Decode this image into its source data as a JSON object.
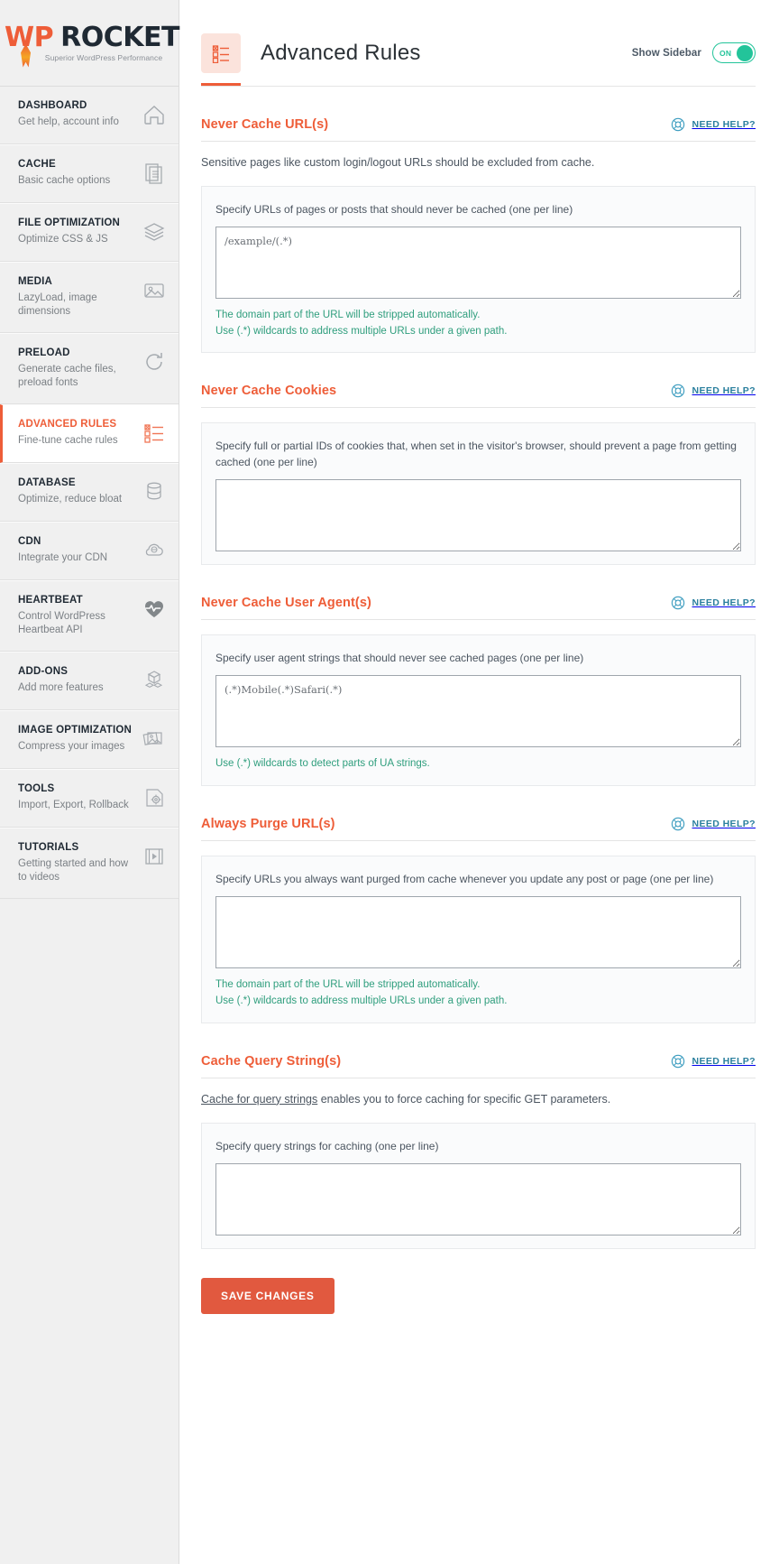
{
  "brand": {
    "logo_wp": "WP",
    "logo_rocket": "ROCKET",
    "tagline": "Superior WordPress Performance",
    "accent_orange": "#ee5d38",
    "accent_green": "#23c49a",
    "accent_teal": "#2a7f9e",
    "hint_green": "#2f9e7d",
    "save_orange": "#e1593f"
  },
  "sidebar": {
    "items": [
      {
        "title": "DASHBOARD",
        "sub": "Get help, account info",
        "icon": "home-icon",
        "active": false
      },
      {
        "title": "CACHE",
        "sub": "Basic cache options",
        "icon": "document-icon",
        "active": false
      },
      {
        "title": "FILE OPTIMIZATION",
        "sub": "Optimize CSS & JS",
        "icon": "layers-icon",
        "active": false
      },
      {
        "title": "MEDIA",
        "sub": "LazyLoad, image dimensions",
        "icon": "image-icon",
        "active": false
      },
      {
        "title": "PRELOAD",
        "sub": "Generate cache files, preload fonts",
        "icon": "refresh-icon",
        "active": false
      },
      {
        "title": "ADVANCED RULES",
        "sub": "Fine-tune cache rules",
        "icon": "rules-list-icon",
        "active": true
      },
      {
        "title": "DATABASE",
        "sub": "Optimize, reduce bloat",
        "icon": "database-icon",
        "active": false
      },
      {
        "title": "CDN",
        "sub": "Integrate your CDN",
        "icon": "cloud-cdn-icon",
        "active": false
      },
      {
        "title": "HEARTBEAT",
        "sub": "Control WordPress Heartbeat API",
        "icon": "heartbeat-icon",
        "active": false
      },
      {
        "title": "ADD-ONS",
        "sub": "Add more features",
        "icon": "addons-cubes-icon",
        "active": false
      },
      {
        "title": "IMAGE OPTIMIZATION",
        "sub": "Compress your images",
        "icon": "photos-stack-icon",
        "active": false
      },
      {
        "title": "TOOLS",
        "sub": "Import, Export, Rollback",
        "icon": "gear-icon",
        "active": false
      },
      {
        "title": "TUTORIALS",
        "sub": "Getting started and how to videos",
        "icon": "video-play-icon",
        "active": false
      }
    ]
  },
  "header": {
    "icon": "rules-list-icon",
    "title": "Advanced Rules",
    "show_sidebar_label": "Show Sidebar",
    "toggle_state": "ON"
  },
  "need_help_label": "NEED HELP?",
  "sections": [
    {
      "title": "Never Cache URL(s)",
      "desc": "Sensitive pages like custom login/logout URLs should be excluded from cache.",
      "desc_link": "",
      "field_label": "Specify URLs of pages or posts that should never be cached (one per line)",
      "textarea_value": "",
      "textarea_placeholder": "/example/(.*)",
      "hints": [
        "The domain part of the URL will be stripped automatically.",
        "Use (.*) wildcards to address multiple URLs under a given path."
      ]
    },
    {
      "title": "Never Cache Cookies",
      "desc": "",
      "desc_link": "",
      "field_label": "Specify full or partial IDs of cookies that, when set in the visitor's browser, should prevent a page from getting cached (one per line)",
      "textarea_value": "",
      "textarea_placeholder": "",
      "hints": []
    },
    {
      "title": "Never Cache User Agent(s)",
      "desc": "",
      "desc_link": "",
      "field_label": "Specify user agent strings that should never see cached pages (one per line)",
      "textarea_value": "",
      "textarea_placeholder": "(.*)Mobile(.*)Safari(.*)",
      "hints": [
        "Use (.*) wildcards to detect parts of UA strings."
      ]
    },
    {
      "title": "Always Purge URL(s)",
      "desc": "",
      "desc_link": "",
      "field_label": "Specify URLs you always want purged from cache whenever you update any post or page (one per line)",
      "textarea_value": "",
      "textarea_placeholder": "",
      "hints": [
        "The domain part of the URL will be stripped automatically.",
        "Use (.*) wildcards to address multiple URLs under a given path."
      ]
    },
    {
      "title": "Cache Query String(s)",
      "desc": " enables you to force caching for specific GET parameters.",
      "desc_link": "Cache for query strings",
      "field_label": "Specify query strings for caching (one per line)",
      "textarea_value": "",
      "textarea_placeholder": "",
      "hints": []
    }
  ],
  "save_button_label": "SAVE CHANGES"
}
